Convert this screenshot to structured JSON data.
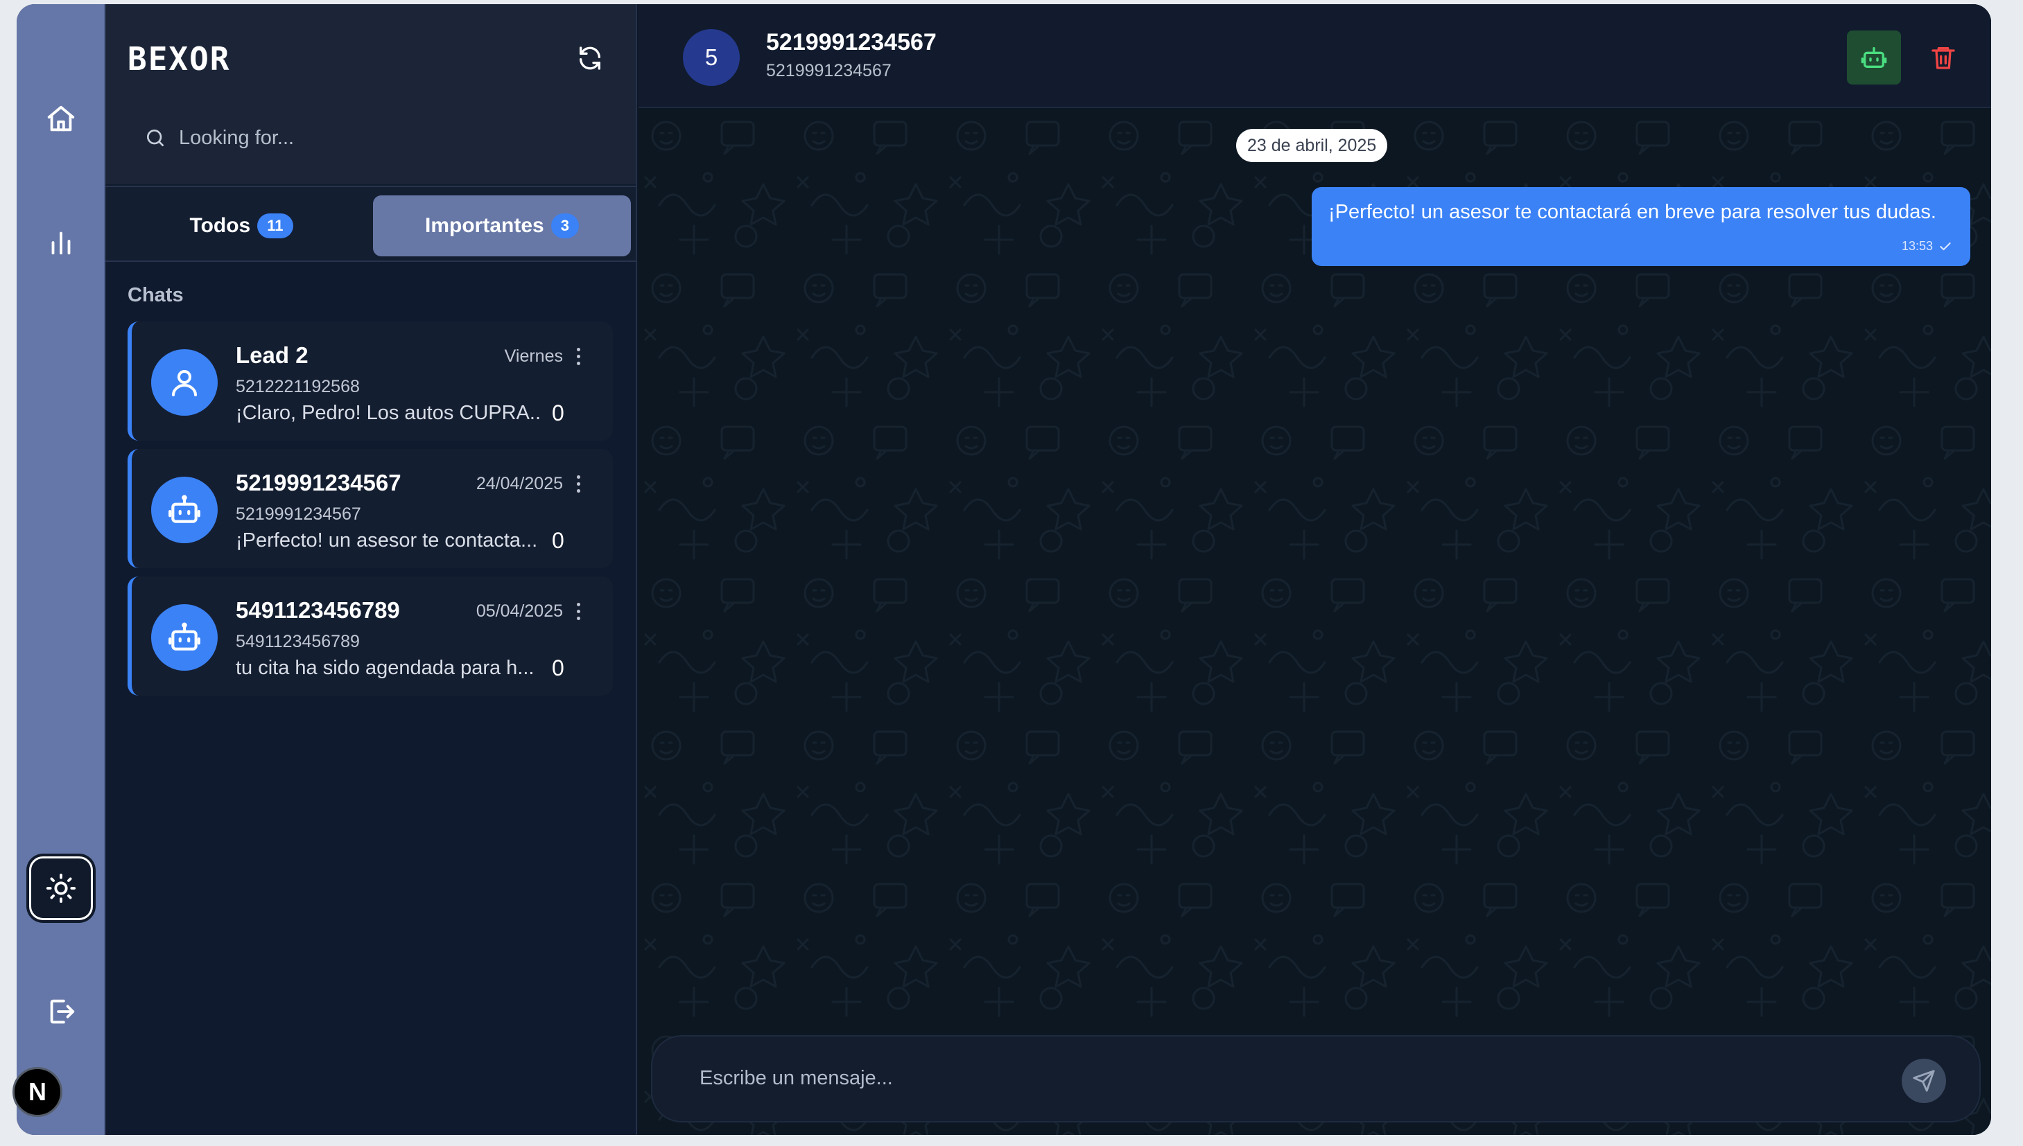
{
  "sidebar": {
    "logo": "BEXOR",
    "search_placeholder": "Looking for...",
    "tabs": [
      {
        "label": "Todos",
        "count": "11"
      },
      {
        "label": "Importantes",
        "count": "3"
      }
    ],
    "section_label": "Chats",
    "chats": [
      {
        "name": "Lead 2",
        "date": "Viernes",
        "phone": "5212221192568",
        "preview": "¡Claro, Pedro! Los autos CUPRA...",
        "count": "0",
        "avatar": "user-icon"
      },
      {
        "name": "5219991234567",
        "date": "24/04/2025",
        "phone": "5219991234567",
        "preview": "¡Perfecto! un asesor te contacta...",
        "count": "0",
        "avatar": "bot-icon"
      },
      {
        "name": "5491123456789",
        "date": "05/04/2025",
        "phone": "5491123456789",
        "preview": "tu cita ha sido agendada para h...",
        "count": "0",
        "avatar": "bot-icon"
      }
    ]
  },
  "header": {
    "avatar_letter": "5",
    "name": "5219991234567",
    "phone": "5219991234567"
  },
  "conversation": {
    "date_chip": "23 de abril, 2025",
    "messages": [
      {
        "text": "¡Perfecto! un asesor te contactará en breve para resolver tus dudas.",
        "time": "13:53"
      }
    ]
  },
  "composer": {
    "placeholder": "Escribe un mensaje..."
  },
  "corner_badge": "N",
  "colors": {
    "accent": "#3b82f6",
    "rail": "#6577a8",
    "background": "#0e1726",
    "bot_button": "#1f4d32",
    "trash": "#ef4444"
  }
}
